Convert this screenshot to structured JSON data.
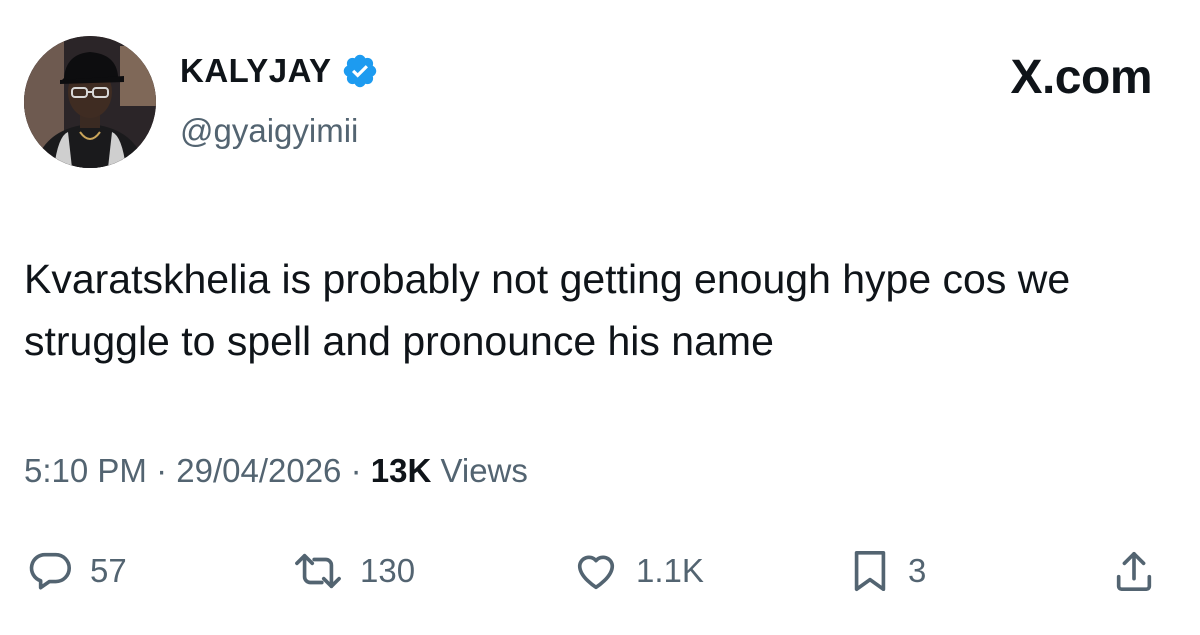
{
  "author": {
    "display_name": "KALYJAY",
    "handle": "@gyaigyimii",
    "verified": true,
    "verified_color": "#1d9bf0"
  },
  "brand": {
    "label": "X.com"
  },
  "tweet": {
    "text": "Kvaratskhelia is probably not getting enough hype cos we struggle to spell and pronounce his name"
  },
  "meta": {
    "time": "5:10 PM",
    "separator": " · ",
    "date": "29/04/2026",
    "views_count": "13K",
    "views_label": " Views"
  },
  "actions": {
    "replies": "57",
    "reposts": "130",
    "likes": "1.1K",
    "bookmarks": "3"
  },
  "icons": [
    "verified-badge-icon",
    "reply-icon",
    "repost-icon",
    "like-icon",
    "bookmark-icon",
    "share-icon"
  ],
  "colors": {
    "text_primary": "#0f1419",
    "text_secondary": "#536471",
    "accent": "#1d9bf0"
  }
}
